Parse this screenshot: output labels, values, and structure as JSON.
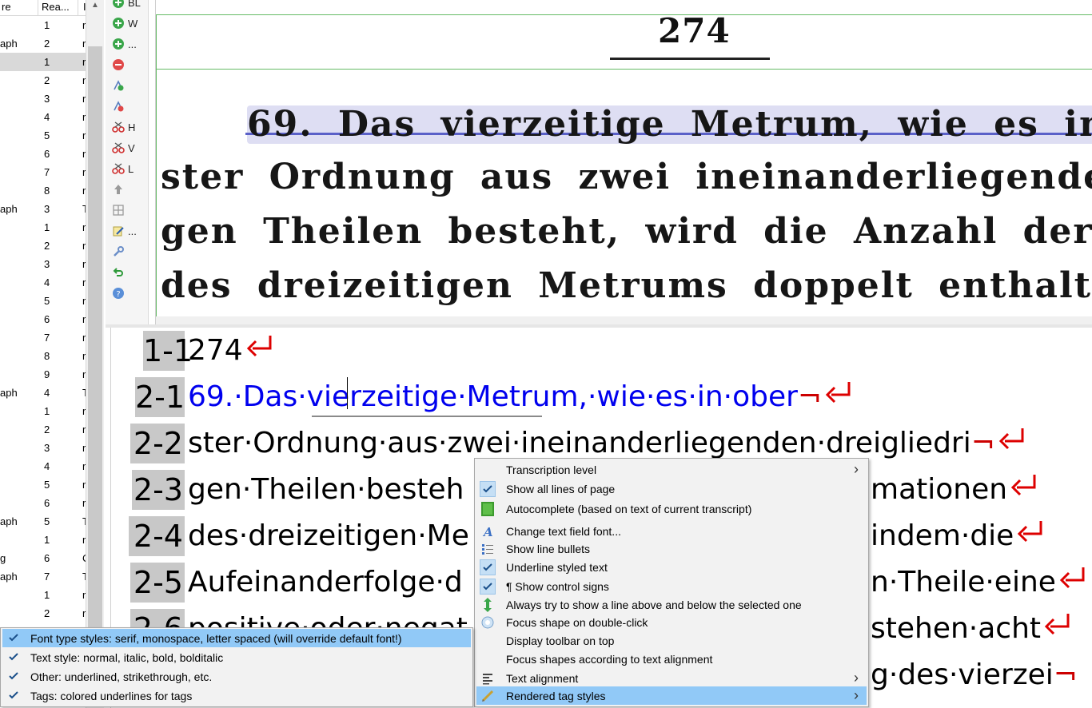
{
  "structure_table": {
    "columns": [
      "re",
      "Rea...",
      "I"
    ],
    "rows": [
      {
        "type": "",
        "reading": "1",
        "c": "r"
      },
      {
        "type": "aph",
        "reading": "2",
        "c": "r"
      },
      {
        "type": "",
        "reading": "1",
        "c": "r",
        "selected": true
      },
      {
        "type": "",
        "reading": "2",
        "c": "r"
      },
      {
        "type": "",
        "reading": "3",
        "c": "r"
      },
      {
        "type": "",
        "reading": "4",
        "c": "r"
      },
      {
        "type": "",
        "reading": "5",
        "c": "r"
      },
      {
        "type": "",
        "reading": "6",
        "c": "r"
      },
      {
        "type": "",
        "reading": "7",
        "c": "r"
      },
      {
        "type": "",
        "reading": "8",
        "c": "r"
      },
      {
        "type": "aph",
        "reading": "3",
        "c": "T"
      },
      {
        "type": "",
        "reading": "1",
        "c": "r"
      },
      {
        "type": "",
        "reading": "2",
        "c": "r"
      },
      {
        "type": "",
        "reading": "3",
        "c": "r"
      },
      {
        "type": "",
        "reading": "4",
        "c": "r"
      },
      {
        "type": "",
        "reading": "5",
        "c": "r"
      },
      {
        "type": "",
        "reading": "6",
        "c": "r"
      },
      {
        "type": "",
        "reading": "7",
        "c": "r"
      },
      {
        "type": "",
        "reading": "8",
        "c": "r"
      },
      {
        "type": "",
        "reading": "9",
        "c": "r"
      },
      {
        "type": "aph",
        "reading": "4",
        "c": "T"
      },
      {
        "type": "",
        "reading": "1",
        "c": "r"
      },
      {
        "type": "",
        "reading": "2",
        "c": "r"
      },
      {
        "type": "",
        "reading": "3",
        "c": "r"
      },
      {
        "type": "",
        "reading": "4",
        "c": "r"
      },
      {
        "type": "",
        "reading": "5",
        "c": "r"
      },
      {
        "type": "",
        "reading": "6",
        "c": "r"
      },
      {
        "type": "aph",
        "reading": "5",
        "c": "T"
      },
      {
        "type": "",
        "reading": "1",
        "c": "r"
      },
      {
        "type": "g",
        "reading": "6",
        "c": "C"
      },
      {
        "type": "aph",
        "reading": "7",
        "c": "T"
      },
      {
        "type": "",
        "reading": "1",
        "c": "r"
      },
      {
        "type": "",
        "reading": "2",
        "c": "r"
      }
    ]
  },
  "toolbar": {
    "items": [
      {
        "icon": "add-baseline-icon",
        "label": "BL"
      },
      {
        "icon": "add-word-icon",
        "label": "W"
      },
      {
        "icon": "add-more-icon",
        "label": "..."
      },
      {
        "icon": "remove-shape-icon",
        "label": ""
      },
      {
        "icon": "add-point-icon",
        "label": ""
      },
      {
        "icon": "remove-point-icon",
        "label": ""
      },
      {
        "icon": "split-horizontal-icon",
        "label": "H"
      },
      {
        "icon": "split-vertical-icon",
        "label": "V"
      },
      {
        "icon": "split-line-icon",
        "label": "L"
      },
      {
        "icon": "move-up-icon",
        "label": ""
      },
      {
        "icon": "table-icon",
        "label": ""
      },
      {
        "icon": "edit-icon",
        "label": "..."
      },
      {
        "icon": "wrench-icon",
        "label": ""
      },
      {
        "icon": "undo-icon",
        "label": ""
      },
      {
        "icon": "help-icon",
        "label": ""
      }
    ]
  },
  "image_viewer": {
    "page_number": "274",
    "lines": [
      "69. Das vierzeitige Metrum, wie es in",
      "ster Ordnung aus zwei ineinanderliegenden dreig",
      "gen Theilen besteht, wird die Anzahl der Form",
      "des dreizeitigen Metrums doppelt enthalten; inde"
    ]
  },
  "text_editor": {
    "lines": [
      {
        "number": "1-1",
        "text": "274",
        "hyphen": false
      },
      {
        "number": "2-1",
        "text": "69.·Das·vierzeitige·Metrum,·wie·es·in·ober",
        "hyphen": true
      },
      {
        "number": "2-2",
        "text": "ster·Ordnung·aus·zwei·ineinanderliegenden·dreigliedri",
        "hyphen": true
      },
      {
        "number": "2-3",
        "text": "gen·Theilen·besteh",
        "tail": "mationen",
        "hyphen": false
      },
      {
        "number": "2-4",
        "text": "des·dreizeitigen·Me",
        "tail": "indem·die",
        "hyphen": false
      },
      {
        "number": "2-5",
        "text": "Aufeinanderfolge·d",
        "tail": "n·Theile·eine",
        "hyphen": false
      },
      {
        "number": "2-6",
        "text": "positive·oder·negat",
        "tail": "stehen·acht",
        "hyphen": false
      },
      {
        "number": "2-7",
        "text": "",
        "tail": "g·des·vierzei",
        "hyphen": true
      }
    ]
  },
  "context_menu": {
    "items": [
      {
        "label": "Transcription level",
        "icon": "",
        "checked": false,
        "submenu": true
      },
      {
        "label": "Show all lines of page",
        "icon": "check-icon",
        "checked": true,
        "submenu": false
      },
      {
        "label": "Autocomplete (based on text of current transcript)",
        "icon": "book-icon",
        "checked": false,
        "submenu": false
      },
      {
        "label": "Change text field font...",
        "icon": "font-icon",
        "checked": false,
        "submenu": false
      },
      {
        "label": "Show line bullets",
        "icon": "bullets-icon",
        "checked": false,
        "submenu": false
      },
      {
        "label": "Underline styled text",
        "icon": "check-icon",
        "checked": true,
        "submenu": false
      },
      {
        "label": "¶ Show control signs",
        "icon": "check-icon",
        "checked": true,
        "submenu": false
      },
      {
        "label": "Always try to show a line above and below the selected one",
        "icon": "arrows-icon",
        "checked": false,
        "submenu": false
      },
      {
        "label": "Focus shape on double-click",
        "icon": "focus-icon",
        "checked": false,
        "submenu": false
      },
      {
        "label": "Display toolbar on top",
        "icon": "",
        "checked": false,
        "submenu": false
      },
      {
        "label": "Focus shapes according to text alignment",
        "icon": "",
        "checked": false,
        "submenu": false
      },
      {
        "label": "Text alignment",
        "icon": "align-icon",
        "checked": false,
        "submenu": true
      },
      {
        "label": "Rendered tag styles",
        "icon": "brush-icon",
        "checked": false,
        "submenu": true,
        "highlighted": true
      }
    ]
  },
  "submenu": {
    "items": [
      {
        "label": "Font type styles: serif, monospace, letter spaced (will override default font!)",
        "checked": true,
        "highlighted": true
      },
      {
        "label": "Text style: normal, italic, bold, bolditalic",
        "checked": true
      },
      {
        "label": "Other: underlined, strikethrough, etc.",
        "checked": true
      },
      {
        "label": "Tags: colored underlines for tags",
        "checked": true
      }
    ]
  },
  "colors": {
    "menu_highlight": "#91c9f7",
    "line_number_bg": "#c8c8c8",
    "control_sign": "#cc0000",
    "selected_line_text": "#0000ee"
  }
}
